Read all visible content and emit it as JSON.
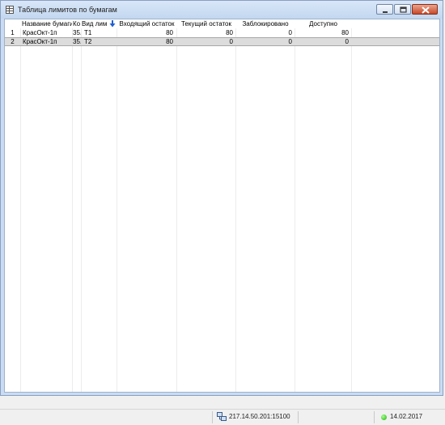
{
  "window": {
    "title": "Таблица лимитов по бумагам",
    "controls": [
      "minimize-icon",
      "maximize-icon",
      "close-icon"
    ]
  },
  "table": {
    "columns": [
      "",
      "Название бумаги",
      "Ко",
      "Вид лим",
      "Входящий остаток",
      "Текущий остаток",
      "Заблокировано",
      "Доступно"
    ],
    "sorted_column_icon": "sort-down-arrow-icon",
    "rows": [
      [
        "1",
        "КрасОкт-1п",
        "35.",
        "T1",
        "80",
        "80",
        "0",
        "80"
      ],
      [
        "2",
        "КрасОкт-1п",
        "35.",
        "T2",
        "80",
        "0",
        "0",
        "0"
      ]
    ],
    "selected_row": 2
  },
  "status": {
    "server_icon": "network-computer-icon",
    "server": "217.14.50.201:15100",
    "connection_icon": "green-status-dot-icon",
    "date": "14.02.2017"
  }
}
